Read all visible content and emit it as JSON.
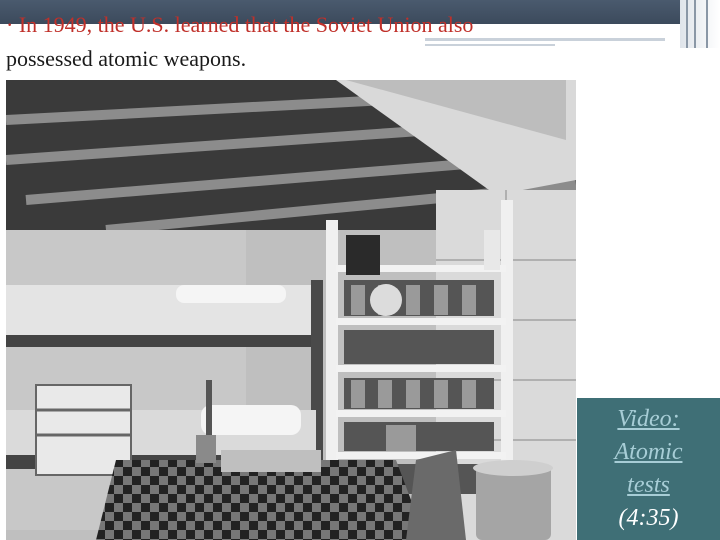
{
  "slide": {
    "bullet_lead": "· In 1949, the U.S. learned that the Soviet Union also",
    "bullet_rest": "possessed atomic weapons."
  },
  "photo": {
    "icon": "fallout-shelter-photo-icon"
  },
  "video": {
    "line1": "Video:",
    "line2": "Atomic",
    "line3": "tests",
    "duration": "(4:35)"
  },
  "colors": {
    "band": "#3c4a5c",
    "lead_text": "#c0302a",
    "video_box": "#3f6f76",
    "video_link": "#a7cdd6"
  }
}
